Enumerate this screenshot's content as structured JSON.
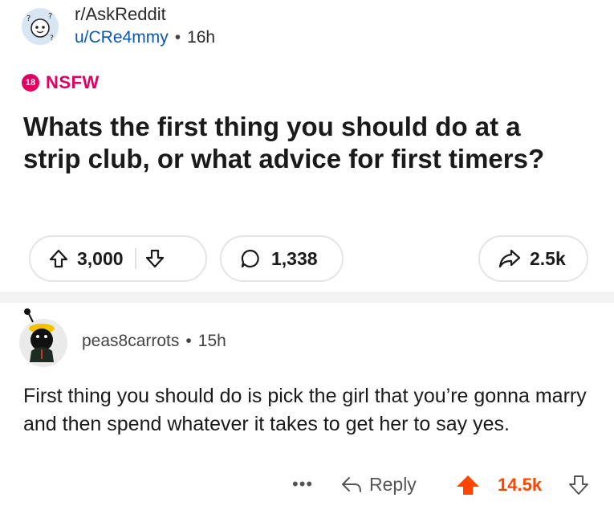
{
  "post": {
    "subreddit": "r/AskReddit",
    "author": "u/CRe4mmy",
    "age": "16h",
    "nsfw_badge": "18",
    "nsfw_label": "NSFW",
    "title": "Whats the first thing you should do at a strip club, or what advice for first timers?",
    "upvotes": "3,000",
    "comments": "1,338",
    "shares": "2.5k"
  },
  "comment": {
    "author": "peas8carrots",
    "age": "15h",
    "body": "First thing you should do is pick the girl that you’re gonna marry and then spend whatever it takes to get her to say yes.",
    "more": "•••",
    "reply_label": "Reply",
    "score": "14.5k"
  },
  "colors": {
    "nsfw": "#e00061",
    "upvote_active": "#ff4500",
    "link": "#0b57b8"
  },
  "icons": [
    "subreddit-avatar-icon",
    "nsfw-badge-icon",
    "upvote-icon",
    "downvote-icon",
    "comment-icon",
    "share-icon",
    "user-avatar-icon",
    "more-icon",
    "reply-icon",
    "upvoted-icon",
    "downvote-small-icon"
  ]
}
